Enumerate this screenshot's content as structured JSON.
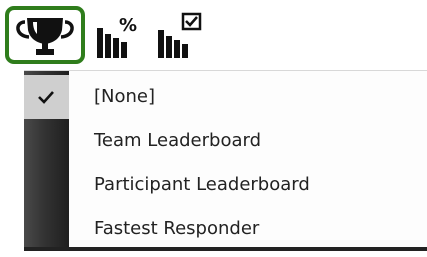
{
  "toolbar": {
    "buttons": [
      {
        "icon": "trophy-icon",
        "selected": true
      },
      {
        "icon": "bar-chart-percent-icon",
        "selected": false
      },
      {
        "icon": "bar-chart-check-icon",
        "selected": false
      }
    ],
    "percent_glyph": "%"
  },
  "menu": {
    "items": [
      {
        "label": "[None]",
        "checked": true
      },
      {
        "label": "Team Leaderboard",
        "checked": false
      },
      {
        "label": "Participant Leaderboard",
        "checked": false
      },
      {
        "label": "Fastest Responder",
        "checked": false
      }
    ]
  },
  "colors": {
    "selection_border": "#2f7d1c",
    "gutter": "#2b2b2b",
    "checked_bg": "#cfcfcf"
  }
}
